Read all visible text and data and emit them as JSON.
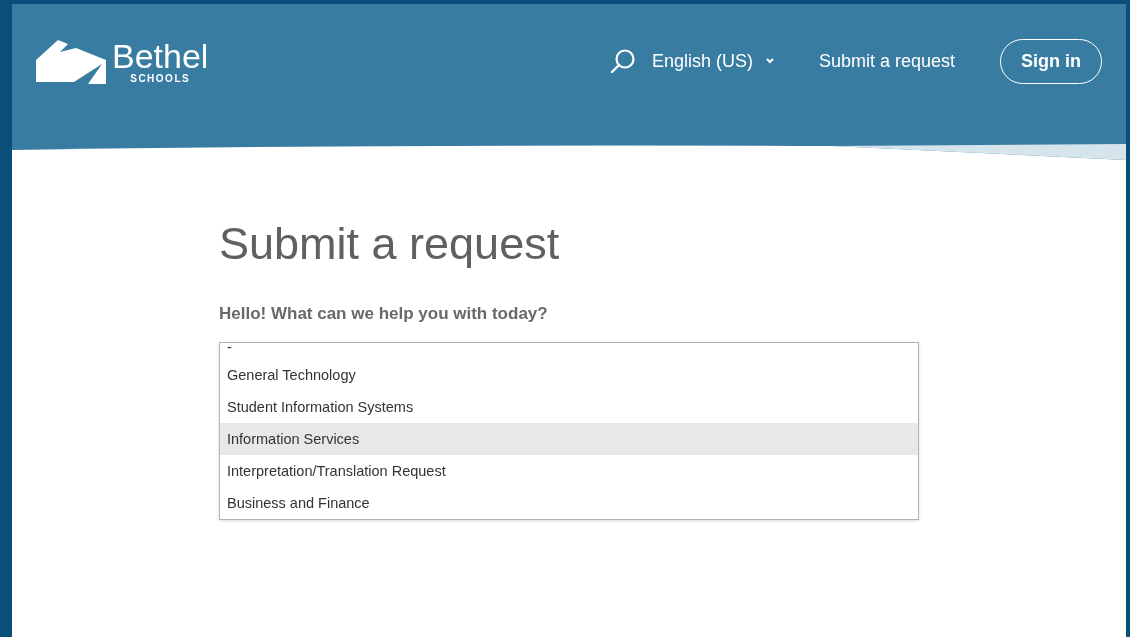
{
  "header": {
    "logo": {
      "name": "Bethel",
      "subtitle": "SCHOOLS"
    },
    "language": "English (US)",
    "nav_link": "Submit a request",
    "sign_in": "Sign in"
  },
  "page": {
    "title": "Submit a request",
    "question": "Hello! What can we help you with today?",
    "options": [
      {
        "label": "-",
        "selected": false
      },
      {
        "label": "General Technology",
        "selected": false
      },
      {
        "label": "Student Information Systems",
        "selected": false
      },
      {
        "label": "Information Services",
        "selected": true
      },
      {
        "label": "Interpretation/Translation Request",
        "selected": false
      },
      {
        "label": "Business and Finance",
        "selected": false
      }
    ]
  }
}
